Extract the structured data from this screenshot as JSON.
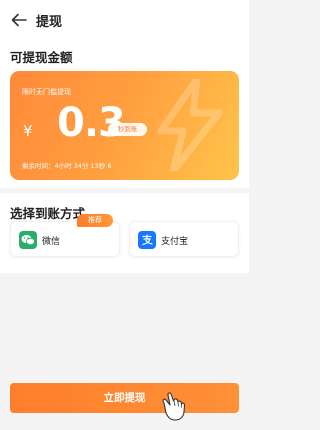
{
  "header": {
    "title": "提现"
  },
  "amount_section": {
    "title": "可提现金额",
    "card": {
      "label": "限时无门槛提现",
      "currency": "¥",
      "amount": "0.3",
      "badge": "秒到账",
      "countdown": "剩余时间：4小时 34分 13秒 6"
    }
  },
  "pay_section": {
    "title": "选择到账方式",
    "options": [
      {
        "label": "微信",
        "icon": "wechat-icon",
        "badge": "推荐"
      },
      {
        "label": "支付宝",
        "icon": "alipay-icon"
      }
    ]
  },
  "withdraw_button": {
    "label": "立即提现"
  },
  "colors": {
    "accent": "#ff8a34",
    "wechat": "#2aae67",
    "alipay": "#1677ff"
  }
}
